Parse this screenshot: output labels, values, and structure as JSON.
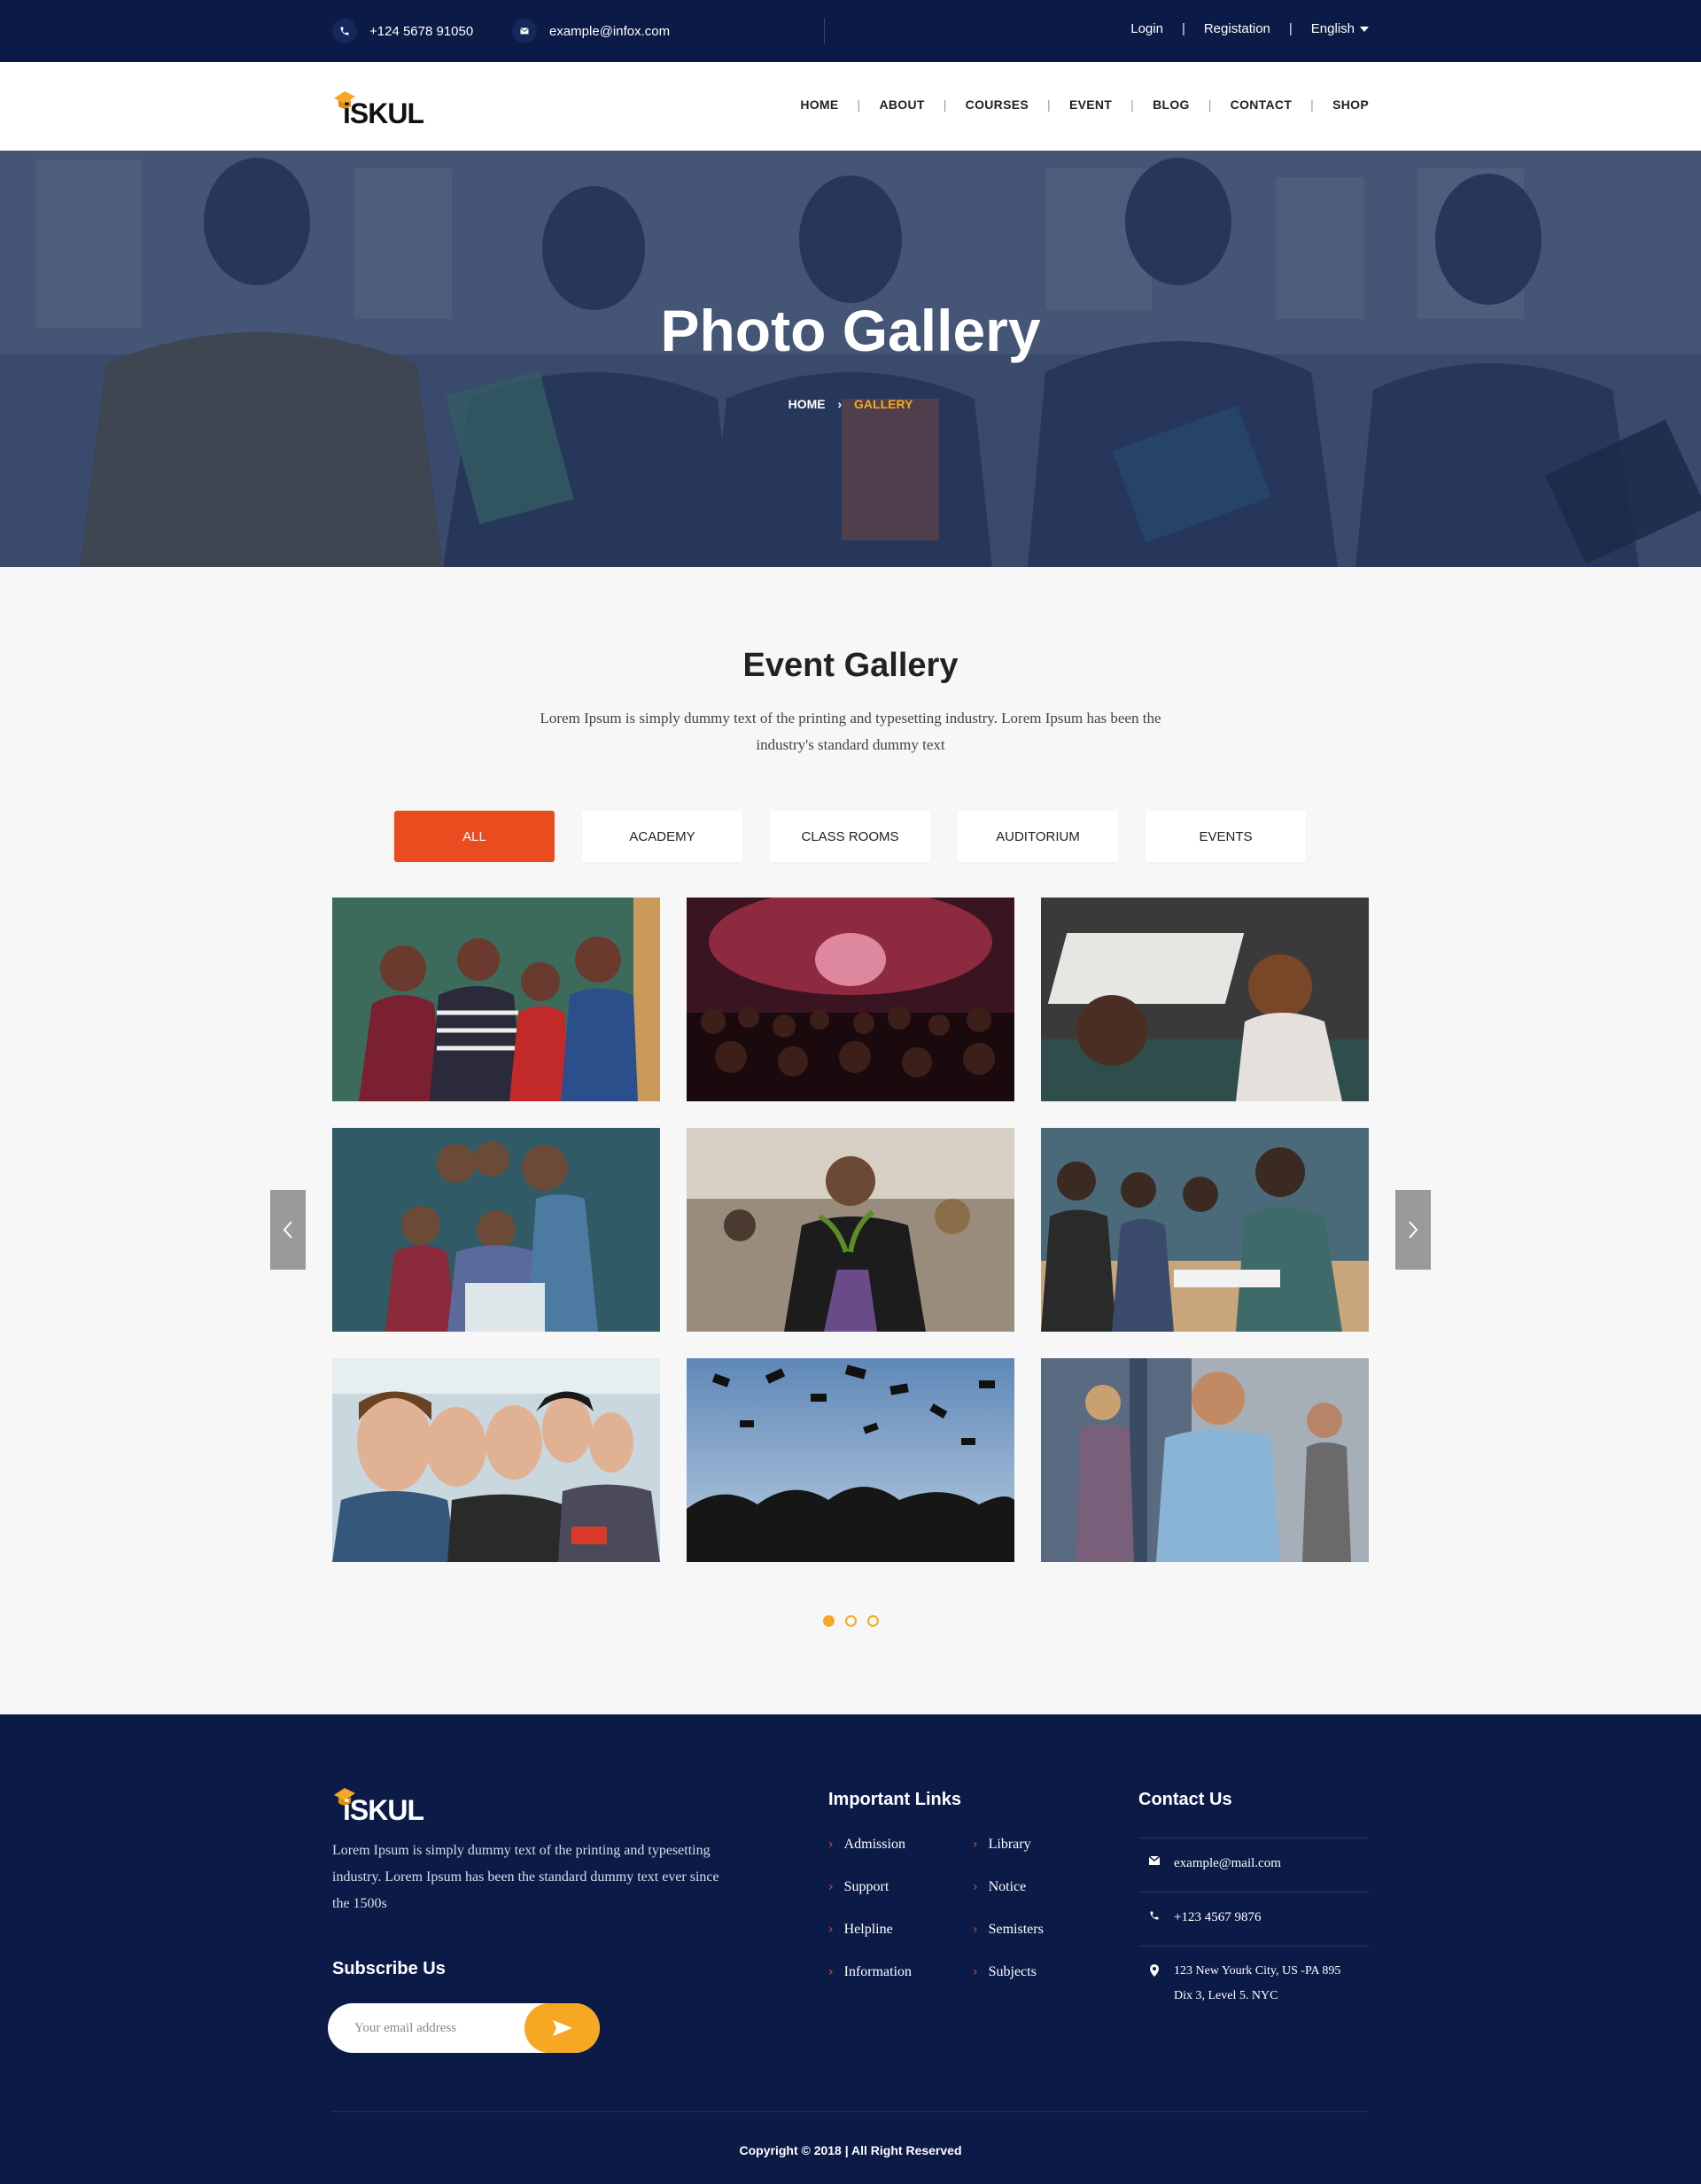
{
  "topbar": {
    "phone": "+124 5678 91050",
    "email": "example@infox.com",
    "login": "Login",
    "separator": "|",
    "registration": "Registation",
    "language": "English"
  },
  "brand": {
    "logo_text": "iSKUL",
    "accent": "#f7a823"
  },
  "nav": {
    "separator": "|",
    "items": [
      {
        "label": "HOME"
      },
      {
        "label": "ABOUT"
      },
      {
        "label": "COURSES"
      },
      {
        "label": "EVENT"
      },
      {
        "label": "BLOG"
      },
      {
        "label": "CONTACT"
      },
      {
        "label": "SHOP"
      }
    ]
  },
  "hero": {
    "title": "Photo Gallery",
    "breadcrumb_home": "HOME",
    "breadcrumb_sep": "›",
    "breadcrumb_current": "GALLERY"
  },
  "gallery": {
    "title": "Event Gallery",
    "description": "Lorem Ipsum is simply dummy text of the printing and typesetting industry. Lorem Ipsum has been the industry's standard dummy text",
    "filters": [
      {
        "label": "ALL",
        "active": true
      },
      {
        "label": "ACADEMY",
        "active": false
      },
      {
        "label": "CLASS ROOMS",
        "active": false
      },
      {
        "label": "AUDITORIUM",
        "active": false
      },
      {
        "label": "EVENTS",
        "active": false
      }
    ],
    "photos": [
      {
        "subject": "students-classroom-photo"
      },
      {
        "subject": "concert-crowd-photo"
      },
      {
        "subject": "lecture-hall-photo"
      },
      {
        "subject": "group-laptop-photo"
      },
      {
        "subject": "student-reading-photo"
      },
      {
        "subject": "students-writing-photo"
      },
      {
        "subject": "friends-smiling-photo"
      },
      {
        "subject": "graduation-caps-photo"
      },
      {
        "subject": "student-thumbs-up-photo"
      }
    ],
    "pages": 3,
    "current_page": 1
  },
  "footer": {
    "about": "Lorem Ipsum is simply dummy text of the printing and typesetting industry. Lorem Ipsum has been the standard dummy text ever since the 1500s",
    "subscribe_title": "Subscribe Us",
    "subscribe_placeholder": "Your email address",
    "links_title": "Important Links",
    "links": [
      "Admission",
      "Library",
      "Support",
      "Notice",
      "Helpline",
      "Semisters",
      "Information",
      "Subjects"
    ],
    "contact_title": "Contact Us",
    "contact_email": "example@mail.com",
    "contact_phone": "+123 4567 9876",
    "contact_address_1": "123 New Yourk City, US -PA 895",
    "contact_address_2": "Dix 3, Level 5. NYC",
    "copyright": "Copyright © 2018 |  All Right Reserved"
  },
  "colors": {
    "navy": "#0b1a47",
    "orange": "#ea4c1f",
    "yellow": "#f7a823"
  }
}
